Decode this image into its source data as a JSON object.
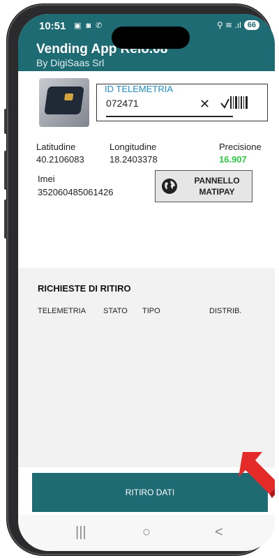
{
  "status_bar": {
    "time": "10:51",
    "left_icons": "▣ ◙ ✆",
    "right_icons": "⚲ ≋ .ıl",
    "battery": "66"
  },
  "header": {
    "title": "Vending App Relo.08",
    "subtitle": "By DigiSaas Srl"
  },
  "telemetry": {
    "label": "ID TELEMETRIA",
    "value": "072471",
    "clear_icon": "close-icon",
    "scan_icon": "barcode-check-icon"
  },
  "location": {
    "lat_label": "Latitudine",
    "lat_value": "40.2106083",
    "lon_label": "Longitudine",
    "lon_value": "18.2403378",
    "prec_label": "Precisione",
    "prec_value": "16.907",
    "imei_label": "Imei",
    "imei_value": "352060485061426"
  },
  "matipay_button": {
    "line1": "PANNELLO",
    "line2": "MATIPAY"
  },
  "requests": {
    "title": "RICHIESTE DI RITIRO",
    "columns": [
      "TELEMETRIA",
      "STATO",
      "TIPO",
      "DISTRIB."
    ]
  },
  "action": {
    "label": "RITIRO DATI"
  },
  "nav": {
    "recents": "|||",
    "home": "○",
    "back": "<"
  },
  "colors": {
    "primary": "#1e6b73",
    "accent_label": "#1e8fc9",
    "precision_green": "#2ecc40",
    "arrow_red": "#e52a2a"
  }
}
